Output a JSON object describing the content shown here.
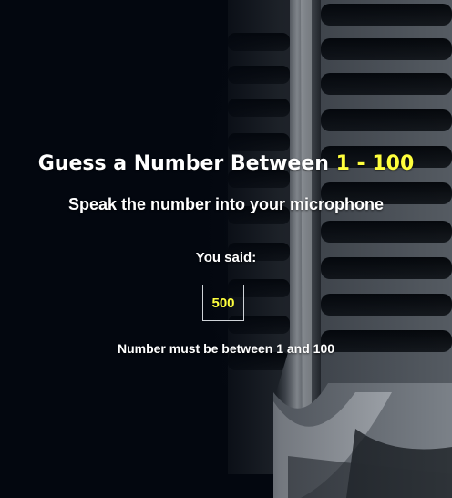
{
  "title": {
    "prefix": "Guess a Number Between ",
    "range": "1 - 100"
  },
  "subtitle": "Speak the number into your microphone",
  "said": {
    "label": "You said:",
    "value": "500"
  },
  "message": "Number must be between 1 and 100",
  "colors": {
    "background": "#03070f",
    "accent": "#ffff3d",
    "text": "#ffffff"
  },
  "icons": {
    "background": "microphone-illustration"
  }
}
